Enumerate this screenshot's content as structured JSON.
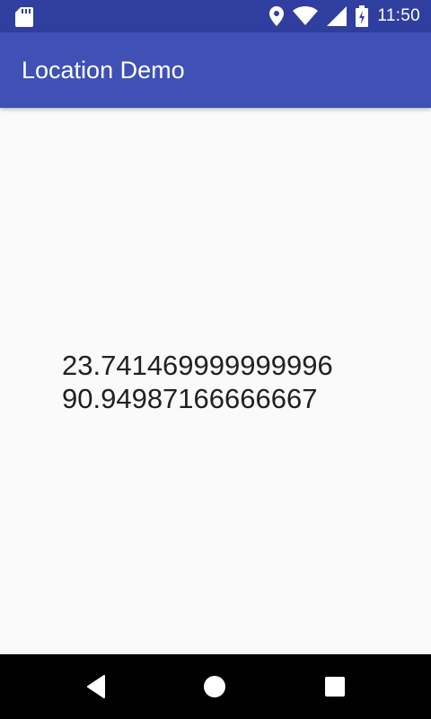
{
  "status_bar": {
    "time": "11:50",
    "icons": [
      "sd-card-icon",
      "location-pin-icon",
      "wifi-icon",
      "cell-signal-icon",
      "battery-charging-icon"
    ]
  },
  "app_bar": {
    "title": "Location Demo"
  },
  "location": {
    "latitude": "23.741469999999996",
    "longitude": "90.94987166666667"
  },
  "nav_bar": {
    "buttons": [
      "back",
      "home",
      "recents"
    ]
  },
  "colors": {
    "status_bar": "#303f9f",
    "app_bar": "#3f51b5",
    "background": "#fafafa",
    "text": "#212121",
    "nav_bar": "#000000"
  }
}
